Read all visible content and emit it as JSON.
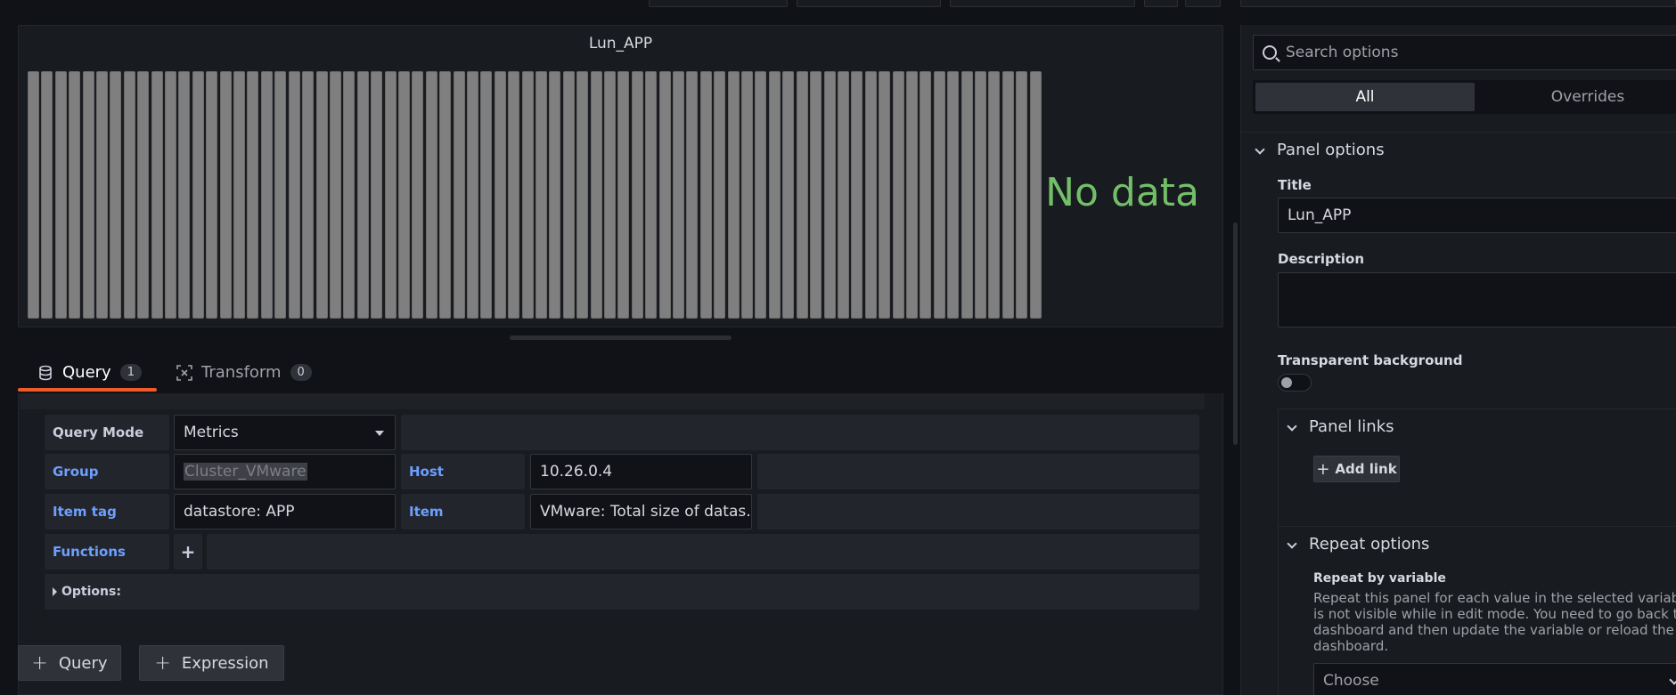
{
  "panel": {
    "title": "Lun_APP",
    "no_data_text": "No data",
    "bar_count": 74,
    "bar_color": "#7f7f7f",
    "no_data_color": "#73bf69"
  },
  "tabs": [
    {
      "label": "Query",
      "count": "1"
    },
    {
      "label": "Transform",
      "count": "0"
    }
  ],
  "query_row": {
    "query_mode_label": "Query Mode",
    "query_mode_value": "Metrics",
    "group_label": "Group",
    "group_value": "Cluster_VMware",
    "host_label": "Host",
    "host_value": "10.26.0.4",
    "item_tag_label": "Item tag",
    "item_tag_value": "datastore: APP",
    "item_label": "Item",
    "item_value": "VMware: Total size of datas...",
    "functions_label": "Functions",
    "functions_add": "+",
    "options_label": "Options:"
  },
  "buttons": {
    "add_query": "Query",
    "add_expression": "Expression"
  },
  "options_pane": {
    "search_placeholder": "Search options",
    "tab_all": "All",
    "tab_overrides": "Overrides",
    "panel_options_title": "Panel options",
    "title_label": "Title",
    "title_value": "Lun_APP",
    "description_label": "Description",
    "transparent_label": "Transparent background",
    "panel_links_title": "Panel links",
    "add_link_label": "Add link",
    "repeat_options_title": "Repeat options",
    "repeat_by_label": "Repeat by variable",
    "repeat_desc_1": "Repeat this panel for each value in the selected variable. Thi",
    "repeat_desc_2": "is not visible while in edit mode. You need to go back to",
    "repeat_desc_3": "dashboard and then update the variable or reload the",
    "repeat_desc_4": "dashboard.",
    "choose_placeholder": "Choose"
  }
}
